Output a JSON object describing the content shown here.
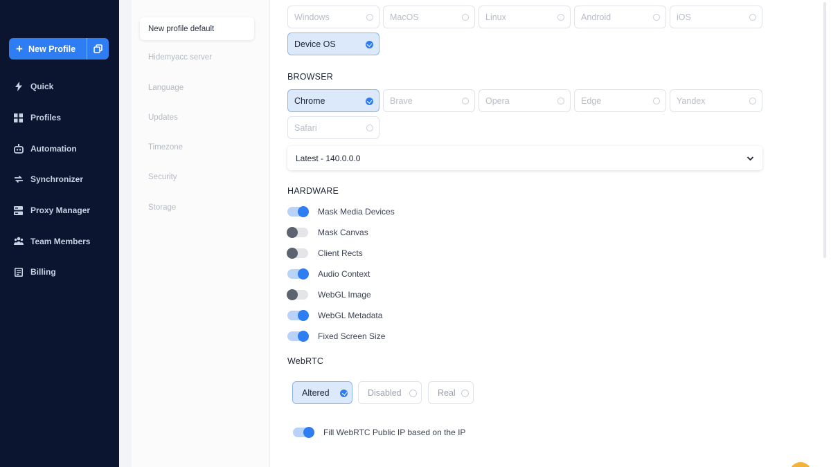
{
  "sidebar": {
    "new_profile_label": "New Profile",
    "items": [
      {
        "label": "Quick",
        "icon": "bolt-icon"
      },
      {
        "label": "Profiles",
        "icon": "grid-icon"
      },
      {
        "label": "Automation",
        "icon": "robot-icon"
      },
      {
        "label": "Synchronizer",
        "icon": "sync-icon"
      },
      {
        "label": "Proxy Manager",
        "icon": "server-icon"
      },
      {
        "label": "Team Members",
        "icon": "team-icon"
      },
      {
        "label": "Billing",
        "icon": "billing-icon"
      }
    ]
  },
  "settings_nav": {
    "items": [
      "New profile default",
      "Hidemyacc server",
      "Language",
      "Updates",
      "Timezone",
      "Security",
      "Storage"
    ],
    "active_index": 0
  },
  "os": {
    "options": [
      "Windows",
      "MacOS",
      "Linux",
      "Android",
      "iOS",
      "Device OS"
    ],
    "selected": "Device OS"
  },
  "browser": {
    "title": "BROWSER",
    "options": [
      "Chrome",
      "Brave",
      "Opera",
      "Edge",
      "Yandex",
      "Safari"
    ],
    "selected": "Chrome",
    "version": "Latest - 140.0.0.0"
  },
  "hardware": {
    "title": "HARDWARE",
    "toggles": [
      {
        "label": "Mask Media Devices",
        "on": true
      },
      {
        "label": "Mask Canvas",
        "on": false
      },
      {
        "label": "Client Rects",
        "on": false
      },
      {
        "label": "Audio Context",
        "on": true
      },
      {
        "label": "WebGL Image",
        "on": false
      },
      {
        "label": "WebGL Metadata",
        "on": true
      },
      {
        "label": "Fixed Screen Size",
        "on": true
      }
    ]
  },
  "webrtc": {
    "title": "WebRTC",
    "options": [
      "Altered",
      "Disabled",
      "Real"
    ],
    "selected": "Altered",
    "fill_ip_label": "Fill WebRTC Public IP based on the IP",
    "fill_ip_on": true
  },
  "colors": {
    "accent": "#2e7df2",
    "sidebar": "#0b1530",
    "selected_bg": "#dce9fb"
  }
}
